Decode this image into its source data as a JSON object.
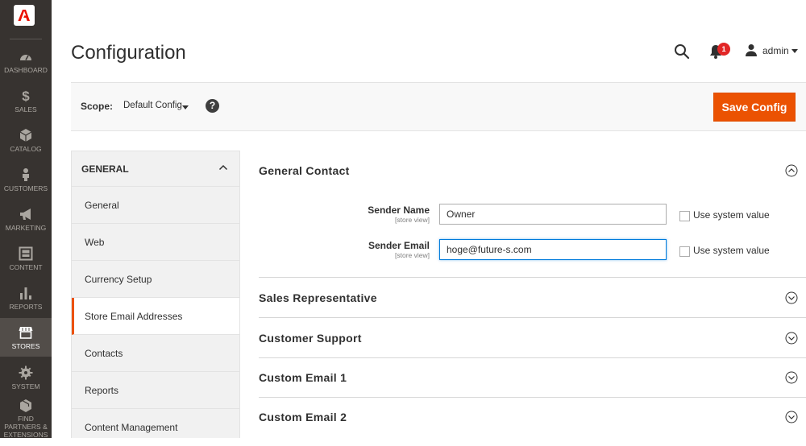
{
  "nav": {
    "items": [
      {
        "label": "DASHBOARD",
        "icon": "dashboard-icon"
      },
      {
        "label": "SALES",
        "icon": "dollar-icon"
      },
      {
        "label": "CATALOG",
        "icon": "cube-icon"
      },
      {
        "label": "CUSTOMERS",
        "icon": "person-icon"
      },
      {
        "label": "MARKETING",
        "icon": "megaphone-icon"
      },
      {
        "label": "CONTENT",
        "icon": "content-icon"
      },
      {
        "label": "REPORTS",
        "icon": "bar-chart-icon"
      },
      {
        "label": "STORES",
        "icon": "store-icon",
        "active": true
      },
      {
        "label": "SYSTEM",
        "icon": "gear-icon"
      },
      {
        "label": "FIND PARTNERS & EXTENSIONS",
        "icon": "box-icon"
      }
    ]
  },
  "header": {
    "title": "Configuration",
    "notification_count": "1",
    "user": "admin"
  },
  "scope": {
    "label": "Scope:",
    "value": "Default Config",
    "help": "?",
    "save_label": "Save Config"
  },
  "sidebar": {
    "group": "GENERAL",
    "items": [
      {
        "label": "General"
      },
      {
        "label": "Web"
      },
      {
        "label": "Currency Setup"
      },
      {
        "label": "Store Email Addresses",
        "active": true
      },
      {
        "label": "Contacts"
      },
      {
        "label": "Reports"
      },
      {
        "label": "Content Management"
      }
    ]
  },
  "main": {
    "sections": [
      {
        "title": "General Contact",
        "expanded": true
      },
      {
        "title": "Sales Representative"
      },
      {
        "title": "Customer Support"
      },
      {
        "title": "Custom Email 1"
      },
      {
        "title": "Custom Email 2"
      }
    ],
    "fields": [
      {
        "label": "Sender Name",
        "scope": "[store view]",
        "value": "Owner",
        "system_label": "Use system value"
      },
      {
        "label": "Sender Email",
        "scope": "[store view]",
        "value": "hoge@future-s.com",
        "system_label": "Use system value"
      }
    ]
  },
  "colors": {
    "accent": "#eb5202",
    "nav_bg": "#373330",
    "focus": "#007bdb"
  }
}
